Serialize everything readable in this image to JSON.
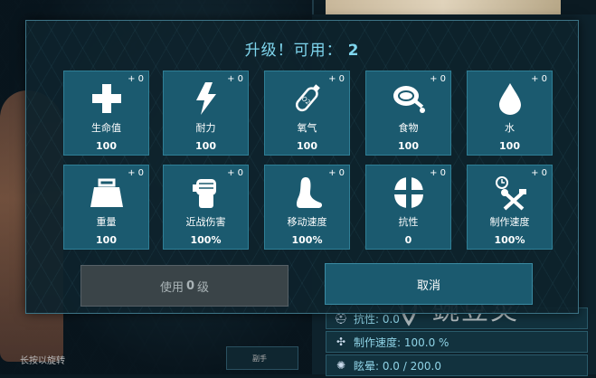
{
  "modal": {
    "title": "升级！可用：",
    "available_points": "2"
  },
  "stats": [
    {
      "id": "health",
      "icon": "health-cross-icon",
      "plus": "+ 0",
      "label": "生命值",
      "value": "100"
    },
    {
      "id": "stamina",
      "icon": "lightning-bolt-icon",
      "plus": "+ 0",
      "label": "耐力",
      "value": "100"
    },
    {
      "id": "oxygen",
      "icon": "oxygen-tank-icon",
      "plus": "+ 0",
      "label": "氧气",
      "value": "100"
    },
    {
      "id": "food",
      "icon": "meat-drumstick-icon",
      "plus": "+ 0",
      "label": "食物",
      "value": "100"
    },
    {
      "id": "water",
      "icon": "water-drop-icon",
      "plus": "+ 0",
      "label": "水",
      "value": "100"
    },
    {
      "id": "weight",
      "icon": "weight-icon",
      "plus": "+ 0",
      "label": "重量",
      "value": "100"
    },
    {
      "id": "melee",
      "icon": "fist-icon",
      "plus": "+ 0",
      "label": "近战伤害",
      "value": "100%"
    },
    {
      "id": "movement",
      "icon": "foot-icon",
      "plus": "+ 0",
      "label": "移动速度",
      "value": "100%"
    },
    {
      "id": "fortitude",
      "icon": "helmet-icon",
      "plus": "+ 0",
      "label": "抗性",
      "value": "0"
    },
    {
      "id": "crafting",
      "icon": "crafting-tools-icon",
      "plus": "+ 0",
      "label": "制作速度",
      "value": "100%"
    }
  ],
  "buttons": {
    "use_prefix": "使用",
    "use_level": "0",
    "use_suffix": "级",
    "cancel": "取消"
  },
  "background": {
    "rotate_hint": "长按以旋转",
    "side_button": "副手",
    "rows": [
      {
        "icon": "helmet-icon",
        "text": "抗性: 0.0"
      },
      {
        "icon": "crafting-tools-icon",
        "text": "制作速度: 100.0 %"
      },
      {
        "icon": "torpor-icon",
        "text": "眩晕: 0.0 / 200.0"
      }
    ]
  },
  "watermark": "豌豆荚"
}
